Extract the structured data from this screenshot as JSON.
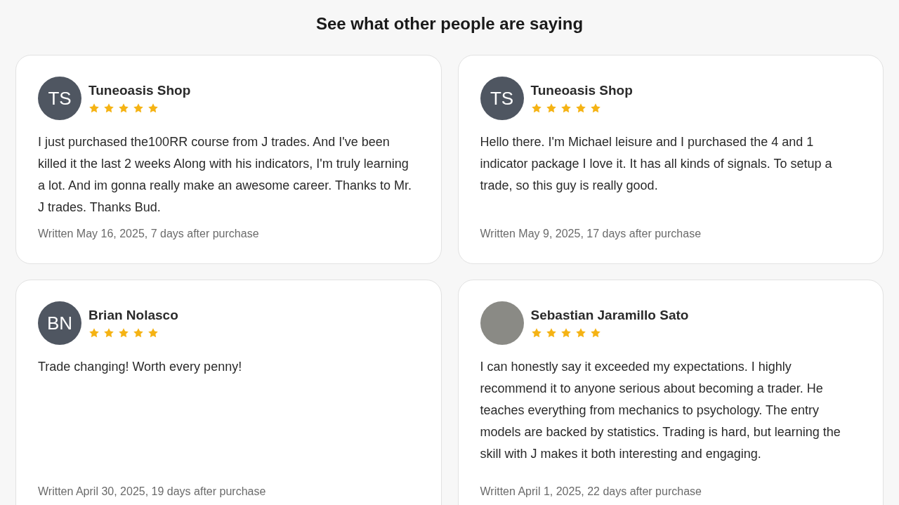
{
  "heading": "See what other people are saying",
  "reviews": [
    {
      "avatar": {
        "kind": "initials",
        "text": "TS"
      },
      "name": "Tuneoasis Shop",
      "stars": 5,
      "text": "I just purchased the100RR course from J trades. And I've been killed it the last 2 weeks Along with his indicators, I'm truly learning a lot. And im gonna really make an awesome career. Thanks to Mr. J trades. Thanks Bud.",
      "written": "Written May 16, 2025, 7 days after purchase"
    },
    {
      "avatar": {
        "kind": "initials",
        "text": "TS"
      },
      "name": "Tuneoasis Shop",
      "stars": 5,
      "text": "Hello there. I'm Michael leisure and I purchased the 4 and 1 indicator package I love it. It has all kinds of signals. To setup a trade, so this guy is really good.",
      "written": "Written May 9, 2025, 17 days after purchase"
    },
    {
      "avatar": {
        "kind": "initials",
        "text": "BN"
      },
      "name": "Brian Nolasco",
      "stars": 5,
      "text": "Trade changing! Worth every penny!",
      "written": "Written April 30, 2025, 19 days after purchase"
    },
    {
      "avatar": {
        "kind": "photo"
      },
      "name": "Sebastian Jaramillo Sato",
      "stars": 5,
      "text": "I can honestly say it exceeded my expectations. I highly recommend it to anyone serious about becoming a trader. He teaches everything from mechanics to psychology. The entry models are backed by statistics. Trading is hard, but learning the skill with J makes it both interesting and engaging.",
      "written": "Written April 1, 2025, 22 days after purchase"
    }
  ]
}
